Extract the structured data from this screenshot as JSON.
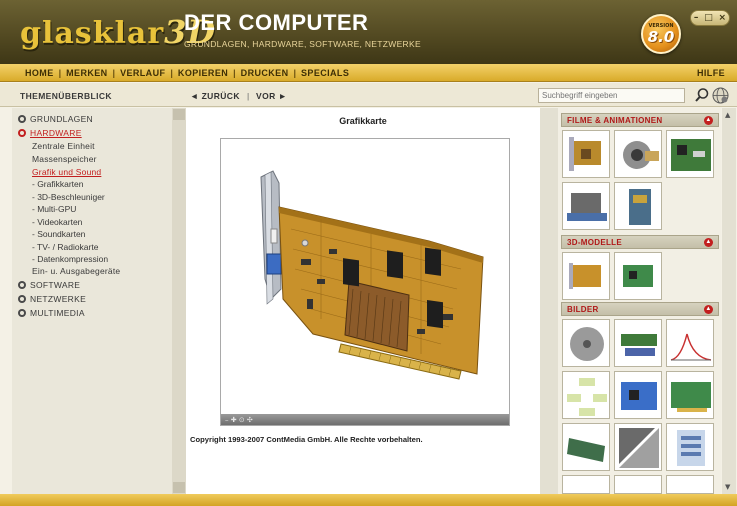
{
  "header": {
    "logo_main": "glasklar",
    "logo_3d": "3D",
    "title": "DER COMPUTER",
    "subtitle": "GRUNDLAGEN, HARDWARE, SOFTWARE, NETZWERKE",
    "version_label": "VERSION",
    "version_number": "8.0"
  },
  "window_controls": {
    "minimize": "–",
    "maximize": "□",
    "close": "×"
  },
  "menu": {
    "items": [
      {
        "label": "HOME"
      },
      {
        "label": "MERKEN"
      },
      {
        "label": "VERLAUF"
      },
      {
        "label": "KOPIEREN"
      },
      {
        "label": "DRUCKEN"
      },
      {
        "label": "SPECIALS"
      }
    ],
    "help": "HILFE"
  },
  "toolbar": {
    "topics": "THEMENÜBERBLICK",
    "back": "◄ ZURÜCK",
    "separator": "|",
    "forward": "VOR ►",
    "search_placeholder": "Suchbegriff eingeben"
  },
  "sidebar": {
    "top_items": [
      {
        "label": "GRUNDLAGEN"
      },
      {
        "label": "HARDWARE"
      },
      {
        "label": "SOFTWARE"
      },
      {
        "label": "NETZWERKE"
      },
      {
        "label": "MULTIMEDIA"
      }
    ],
    "hardware_children": [
      {
        "label": "Zentrale Einheit"
      },
      {
        "label": "Massenspeicher"
      },
      {
        "label": "Grafik und Sound"
      }
    ],
    "grafik_children": [
      {
        "label": "- Grafikkarten"
      },
      {
        "label": "- 3D-Beschleuniger"
      },
      {
        "label": "- Multi-GPU"
      },
      {
        "label": "- Videokarten"
      },
      {
        "label": "- Soundkarten"
      },
      {
        "label": "- TV- / Radiokarte"
      },
      {
        "label": "- Datenkompression"
      }
    ],
    "after_grafik": {
      "label": "Ein- u. Ausgabegeräte"
    }
  },
  "content": {
    "title": "Grafikkarte",
    "copyright": "Copyright 1993-2007 ContMedia GmbH. Alle Rechte vorbehalten.",
    "viewer_controls": "– ✚ ⊙ ✣"
  },
  "media": {
    "sections": [
      {
        "title": "FILME & ANIMATIONEN",
        "toggle": "▲"
      },
      {
        "title": "3D-MODELLE",
        "toggle": "▲"
      },
      {
        "title": "BILDER",
        "toggle": "▲"
      }
    ]
  },
  "scroll": {
    "up": "▲",
    "down": "▼"
  },
  "colors": {
    "header_bg": "#534a22",
    "menubar_bg": "#e6bd44",
    "accent_red": "#c21f1f",
    "logo_gold": "#e8c23a"
  }
}
